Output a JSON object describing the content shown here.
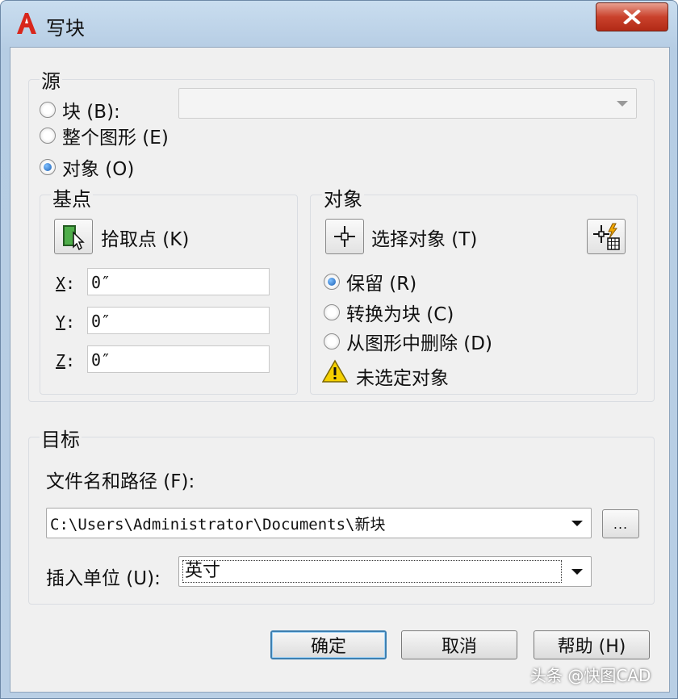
{
  "window": {
    "title": "写块"
  },
  "source": {
    "group_label": "源",
    "radio_block": "块 (B):",
    "radio_entire": "整个图形 (E)",
    "radio_objects": "对象 (O)",
    "selected": "objects",
    "block_combo_value": ""
  },
  "basepoint": {
    "group_label": "基点",
    "pick_label": "拾取点 (K)",
    "x_label": "X",
    "y_label": "Y",
    "z_label": "Z",
    "x_value": "0″",
    "y_value": "0″",
    "z_value": "0″"
  },
  "objects": {
    "group_label": "对象",
    "select_label": "选择对象 (T)",
    "radio_retain": "保留 (R)",
    "radio_convert": "转换为块 (C)",
    "radio_delete": "从图形中删除 (D)",
    "selected": "retain",
    "warning": "未选定对象"
  },
  "destination": {
    "group_label": "目标",
    "path_label": "文件名和路径 (F):",
    "path_value": "C:\\Users\\Administrator\\Documents\\新块",
    "browse_label": "...",
    "units_label": "插入单位 (U):",
    "units_value": "英寸"
  },
  "buttons": {
    "ok": "确定",
    "cancel": "取消",
    "help": "帮助 (H)"
  },
  "watermark": "头条 @快图CAD",
  "colors": {
    "accent": "#1a5fb4",
    "close": "#c9412c",
    "warning": "#f5d000"
  }
}
